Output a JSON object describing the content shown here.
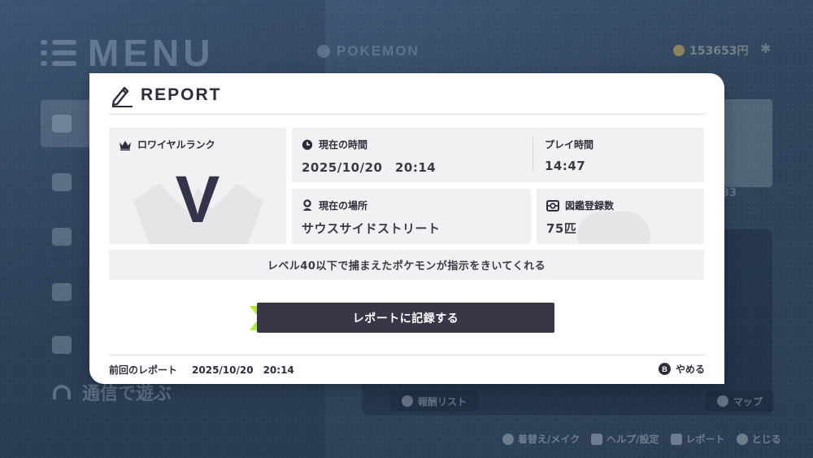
{
  "background": {
    "menu_title": "MENU",
    "tab_label": "POKEMON",
    "money": "153653円",
    "card_number": "33",
    "communication_label": "通信で遊ぶ",
    "reward_list_key": "X",
    "reward_list_label": "報酬リスト",
    "map_label": "マップ",
    "hints": [
      {
        "key": "−",
        "label": "着替え/メイク"
      },
      {
        "key": "L",
        "label": "ヘルプ/設定"
      },
      {
        "key": "R",
        "label": "レポート"
      },
      {
        "key": "B",
        "label": "とじる"
      }
    ]
  },
  "report": {
    "title": "REPORT",
    "rank": {
      "label": "ロワイヤルランク",
      "value": "V"
    },
    "current_time": {
      "label": "現在の時間",
      "value": "2025/10/20　20:14"
    },
    "play_time": {
      "label": "プレイ時間",
      "value": "14:47"
    },
    "location": {
      "label": "現在の場所",
      "value": "サウスサイドストリート"
    },
    "pokedex": {
      "label": "図鑑登録数",
      "value": "75匹"
    },
    "info": "レベル40以下で捕まえたポケモンが指示をきいてくれる",
    "record_button": "レポートに記録する",
    "previous_report": {
      "label": "前回のレポート",
      "value": "2025/10/20　20:14"
    },
    "cancel": {
      "key": "B",
      "label": "やめる"
    }
  },
  "colors": {
    "accent_chevron": "#b5e834",
    "button_bg": "#373748",
    "dialog_bg": "#ffffff",
    "tile_bg": "#f1f1f3"
  },
  "icons": [
    "menu-icon",
    "pencil-icon",
    "crown-icon",
    "clock-icon",
    "pin-icon",
    "pokedex-icon",
    "b-button-icon",
    "wifi-icon",
    "coin-icon",
    "gear-icon"
  ]
}
